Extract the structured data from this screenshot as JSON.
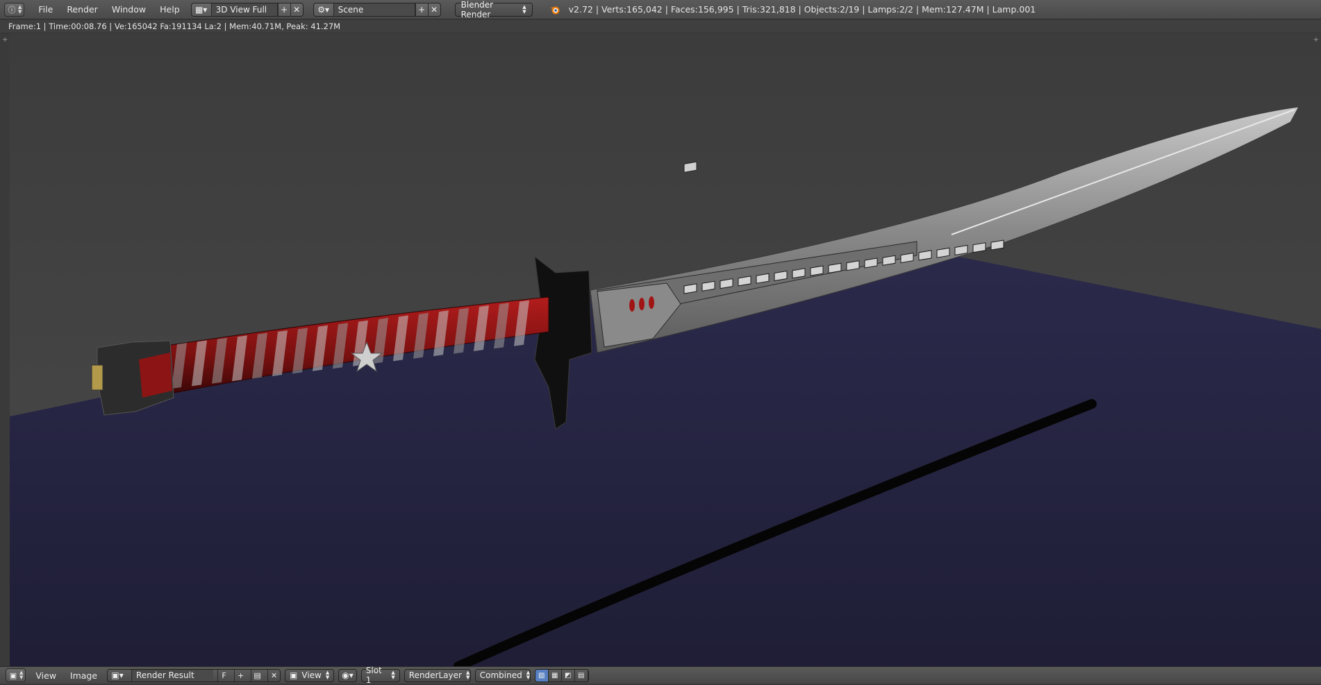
{
  "topbar": {
    "menus": [
      "File",
      "Render",
      "Window",
      "Help"
    ],
    "screen_layout": "3D View Full",
    "scene": "Scene",
    "renderer": "Blender Render",
    "stats": "v2.72 | Verts:165,042 | Faces:156,995 | Tris:321,818 | Objects:2/19 | Lamps:2/2 | Mem:127.47M | Lamp.001"
  },
  "infobar": {
    "text": "Frame:1 | Time:00:08.76 | Ve:165042 Fa:191134 La:2 | Mem:40.71M, Peak: 41.27M"
  },
  "bottombar": {
    "menus": [
      "View",
      "Image"
    ],
    "image_name": "Render Result",
    "fake_user": "F",
    "view_menu": "View",
    "slot": "Slot 1",
    "render_layer": "RenderLayer",
    "pass": "Combined"
  },
  "colors": {
    "ui_header": "#4a4a4a",
    "floor": "#23223f",
    "wall": "#444444",
    "handle_wrap": "#8c1414",
    "active_toggle": "#5680c2"
  },
  "icons": [
    "info-icon",
    "screen-layout-icon",
    "scene-icon",
    "blender-logo-icon",
    "image-editor-icon",
    "image-browse-icon",
    "pin-icon"
  ]
}
